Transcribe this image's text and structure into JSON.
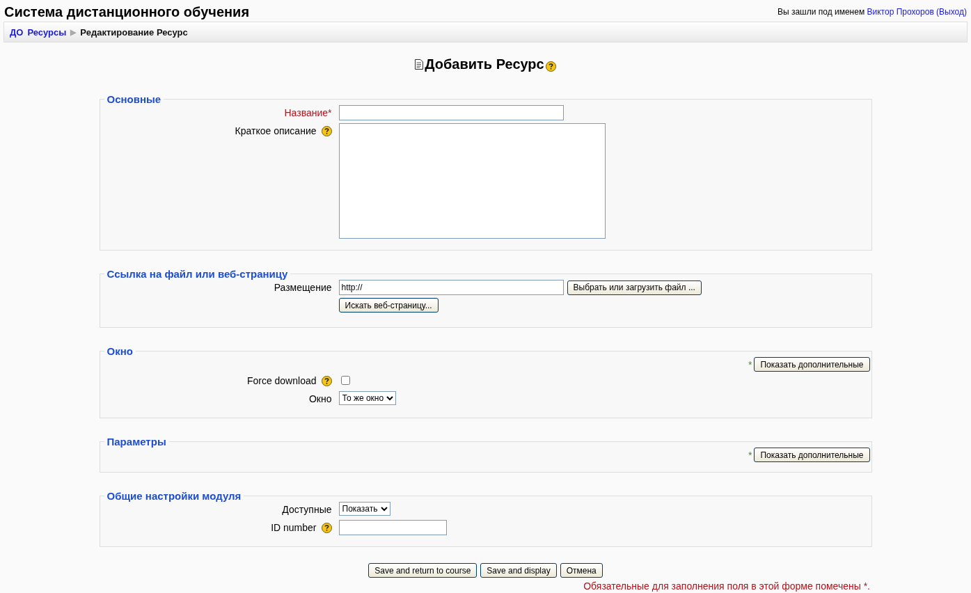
{
  "site_title": "Система дистанционного обучения",
  "login": {
    "prefix": "Вы зашли под именем",
    "user": "Виктор Прохоров",
    "logout": "(Выход)"
  },
  "breadcrumb": [
    {
      "label": "ДО",
      "current": false
    },
    {
      "label": "Ресурсы",
      "current": false
    },
    {
      "label": "Редактирование Ресурс",
      "current": true,
      "separator": "▶"
    }
  ],
  "heading": {
    "title": "Добавить Ресурс",
    "help": true
  },
  "sections": [
    {
      "legend": "Основные",
      "fields": [
        {
          "kind": "text",
          "label": "Название",
          "required": true,
          "marker": "*",
          "help": false
        },
        {
          "kind": "textarea",
          "label": "Краткое описание",
          "required": false,
          "help": true
        }
      ]
    },
    {
      "legend": "Ссылка на файл или веб-страницу",
      "fields": [
        {
          "kind": "text",
          "label": "Размещение",
          "required": false,
          "help": false,
          "value": "http://",
          "button": "Выбрать или загрузить файл ..."
        },
        {
          "kind": "button",
          "button": "Искать веб-страницу..."
        }
      ]
    },
    {
      "legend": "Окно",
      "advanced": {
        "marker": "*",
        "label": "Показать дополнительные"
      },
      "fields": [
        {
          "kind": "checkbox",
          "label": "Force download",
          "required": false,
          "help": true,
          "checked": false
        },
        {
          "kind": "select",
          "label": "Окно",
          "required": false,
          "help": false,
          "value": "То же окно"
        }
      ]
    },
    {
      "legend": "Параметры",
      "advanced": {
        "marker": "*",
        "label": "Показать дополнительные"
      }
    },
    {
      "legend": "Общие настройки модуля",
      "fields": [
        {
          "kind": "select",
          "label": "Доступные",
          "required": false,
          "help": false,
          "value": "Показать"
        },
        {
          "kind": "short_text",
          "label": "ID number",
          "required": false,
          "help": true
        }
      ]
    }
  ],
  "buttons": [
    "Save and return to course",
    "Save and display",
    "Отмена"
  ],
  "required_note": "Обязательные для заполнения поля в этой форме помечены *."
}
